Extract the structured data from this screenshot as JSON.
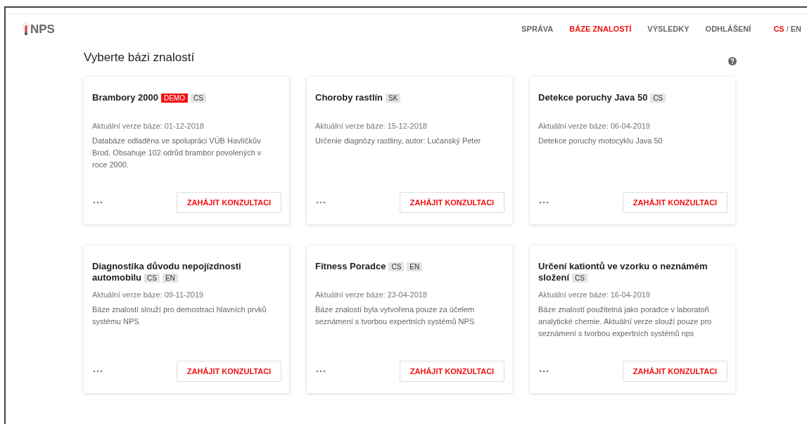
{
  "logo": {
    "text": "NPS"
  },
  "nav": [
    {
      "label": "SPRÁVA",
      "selected": false
    },
    {
      "label": "BÁZE ZNALOSTÍ",
      "selected": true
    },
    {
      "label": "VÝSLEDKY",
      "selected": false
    },
    {
      "label": "ODHLÁŠENÍ",
      "selected": false
    }
  ],
  "languages": {
    "items": [
      {
        "label": "CS",
        "selected": true
      },
      {
        "label": "EN",
        "selected": false
      }
    ],
    "separator": "/"
  },
  "page_title": "Vyberte bázi znalostí",
  "cards": [
    {
      "title": "Brambory 2000",
      "tags": [
        {
          "label": "DEMO",
          "kind": "demo"
        },
        {
          "label": "CS",
          "kind": "lang"
        }
      ],
      "version": "Aktuální verze báze: 01-12-2018",
      "description": "Databáze odladěna ve spolupráci VÚB Havlíčkův Brod. Obsahuje 102 odrůd brambor povolených v roce 2000.",
      "button": "ZAHÁJIT KONZULTACI"
    },
    {
      "title": "Choroby rastlín",
      "tags": [
        {
          "label": "SK",
          "kind": "lang"
        }
      ],
      "version": "Aktuální verze báze: 15-12-2018",
      "description": "Určenie diagnózy rastliny, autor: Lučanský Peter",
      "button": "ZAHÁJIT KONZULTACI"
    },
    {
      "title": "Detekce poruchy Java 50",
      "tags": [
        {
          "label": "CS",
          "kind": "lang"
        }
      ],
      "version": "Aktuální verze báze: 06-04-2019",
      "description": "Detekce poruchy motocyklu Java 50",
      "button": "ZAHÁJIT KONZULTACI"
    },
    {
      "title": "Diagnostika důvodu nepojízdnosti automobilu",
      "tags": [
        {
          "label": "CS",
          "kind": "lang"
        },
        {
          "label": "EN",
          "kind": "lang"
        }
      ],
      "version": "Aktuální verze báze: 09-11-2019",
      "description": "Báze znalostí slouží pro demostraci hlavních prvků systému NPS",
      "button": "ZAHÁJIT KONZULTACI"
    },
    {
      "title": "Fitness Poradce",
      "tags": [
        {
          "label": "CS",
          "kind": "lang"
        },
        {
          "label": "EN",
          "kind": "lang"
        }
      ],
      "version": "Aktuální verze báze: 23-04-2018",
      "description": "Báze znalostí byla vytvořena pouze za účelem seznámení s tvorbou expertních systémů NPS",
      "button": "ZAHÁJIT KONZULTACI"
    },
    {
      "title": "Určení kationtů ve vzorku o neznámém složení",
      "tags": [
        {
          "label": "CS",
          "kind": "lang"
        }
      ],
      "version": "Aktuální verze báze: 16-04-2019",
      "description": "Báze znalostí použitelná jako poradce v laboratoři analytické chemie. Aktuální verze slouží pouze pro seznámení s tvorbou expertních systémů nps",
      "button": "ZAHÁJIT KONZULTACI"
    }
  ]
}
